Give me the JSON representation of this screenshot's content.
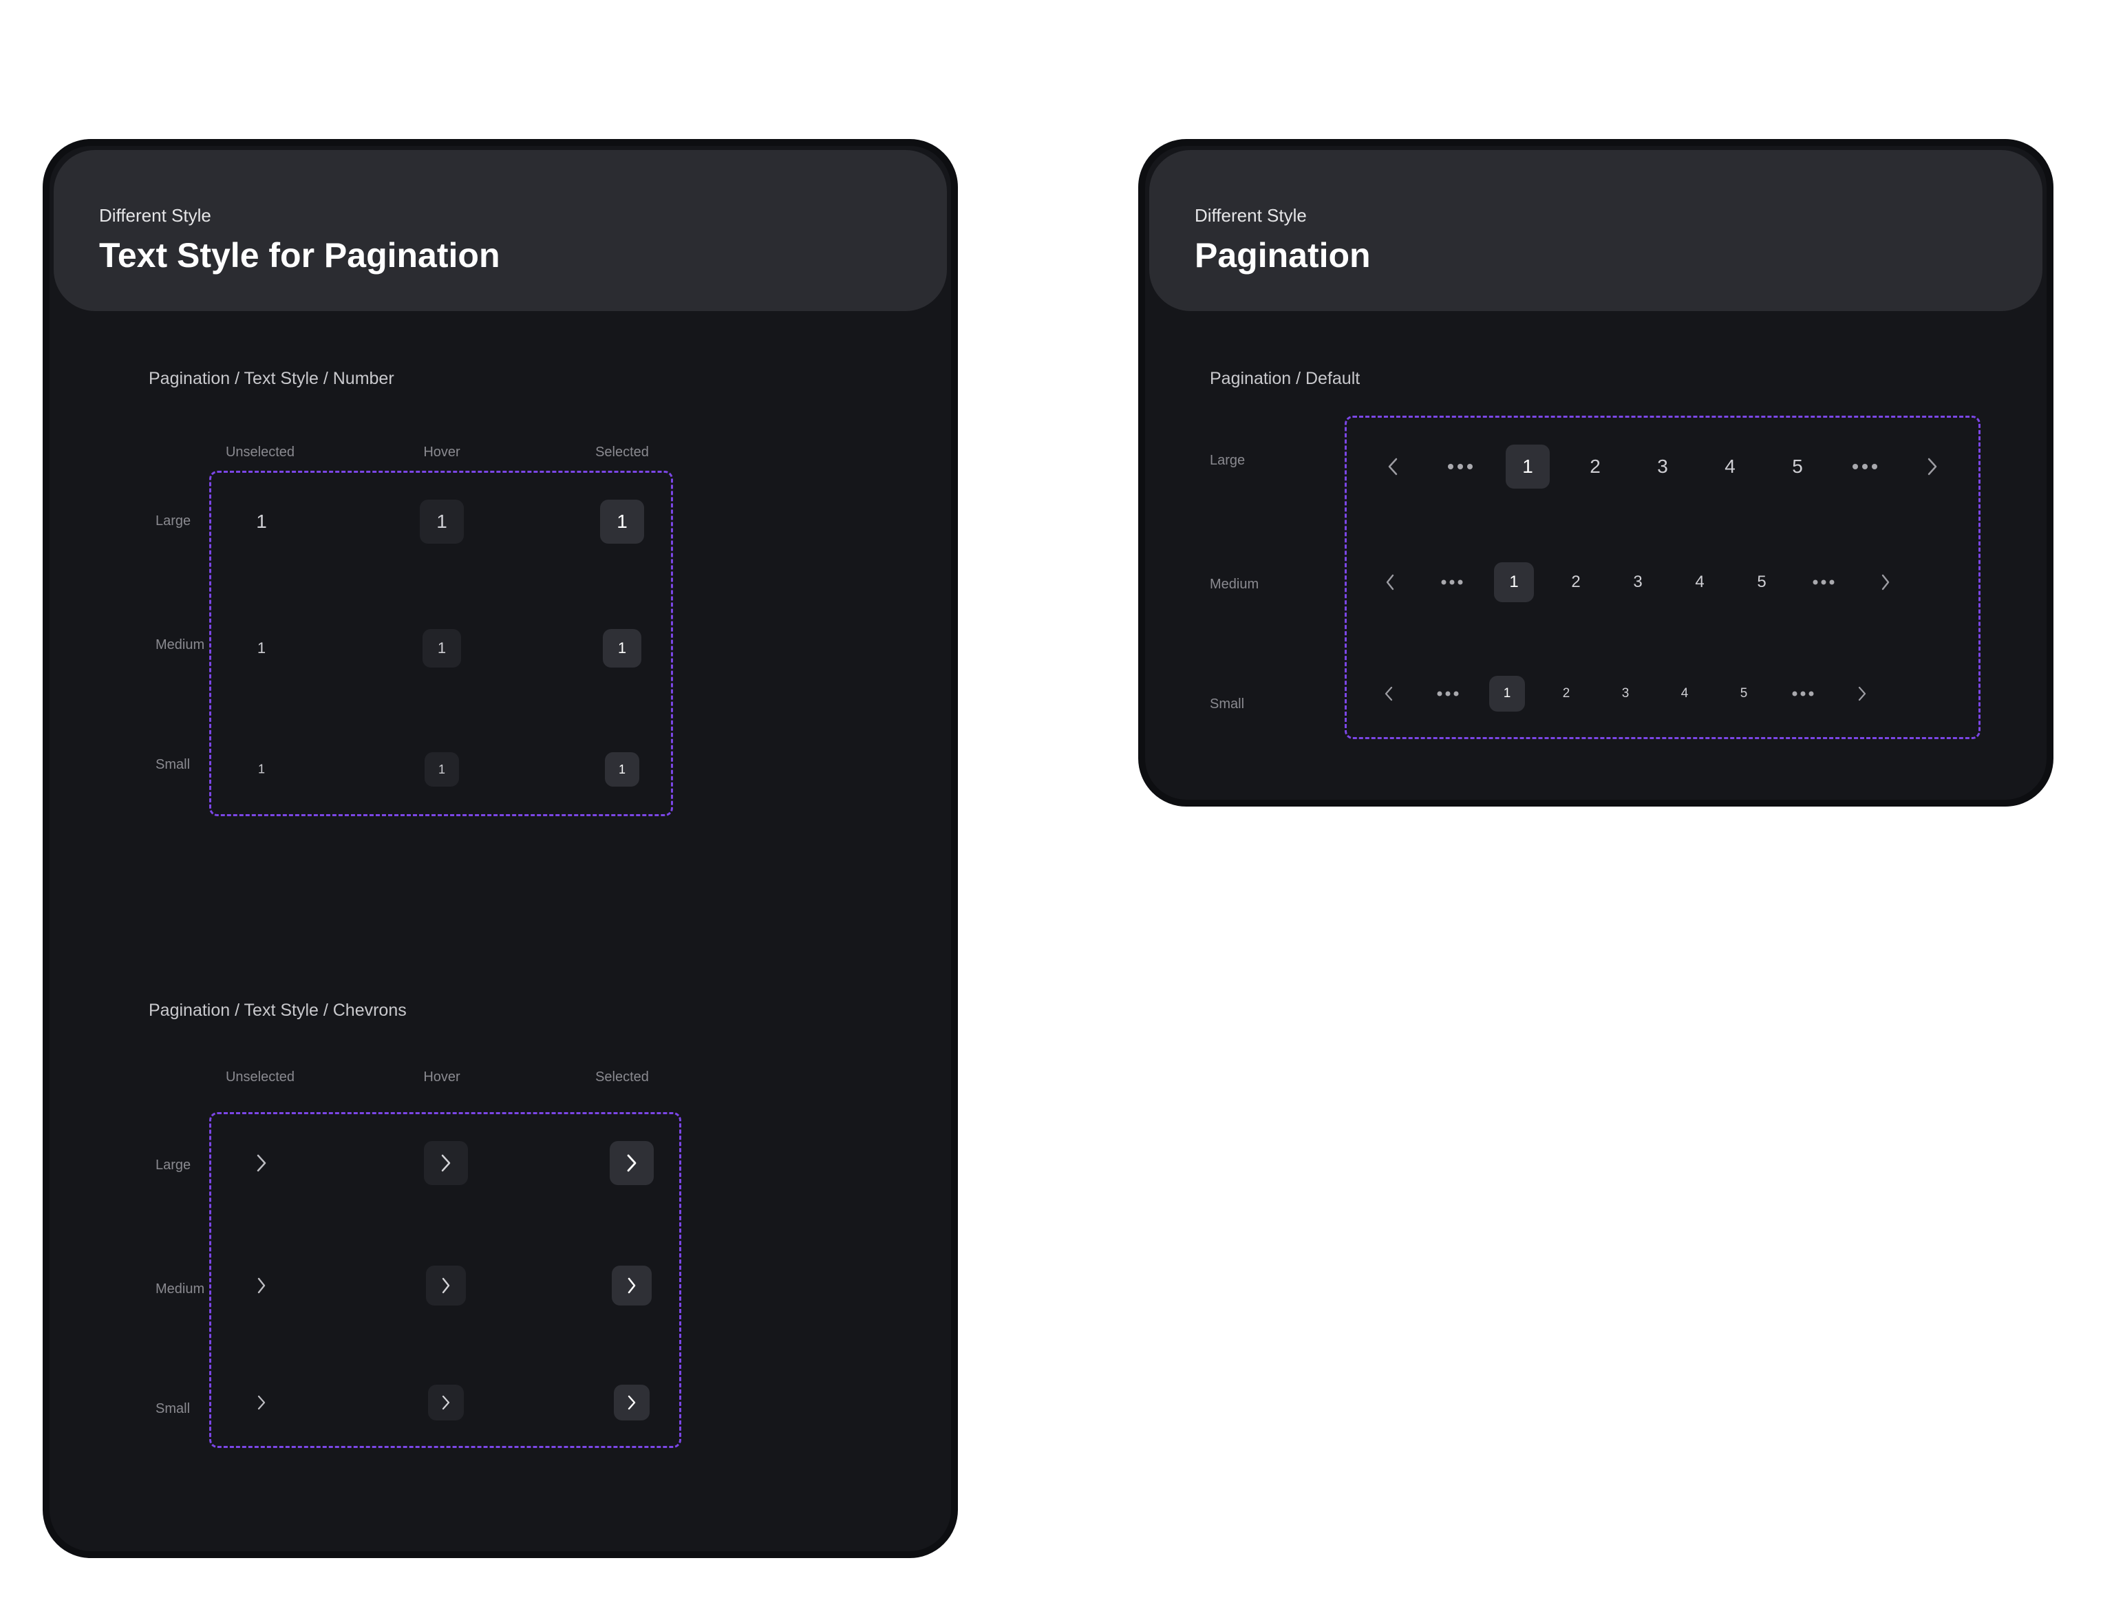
{
  "left_card": {
    "subtitle": "Different Style",
    "title": "Text Style for Pagination",
    "number_section": {
      "title": "Pagination / Text Style / Number",
      "columns": [
        "Unselected",
        "Hover",
        "Selected"
      ],
      "rows": [
        "Large",
        "Medium",
        "Small"
      ],
      "value": "1"
    },
    "chevron_section": {
      "title": "Pagination / Text Style / Chevrons",
      "columns": [
        "Unselected",
        "Hover",
        "Selected"
      ],
      "rows": [
        "Large",
        "Medium",
        "Small"
      ]
    }
  },
  "right_card": {
    "subtitle": "Different Style",
    "title": "Pagination",
    "default_section": {
      "title": "Pagination / Default",
      "rows": [
        "Large",
        "Medium",
        "Small"
      ],
      "pages": [
        "1",
        "2",
        "3",
        "4",
        "5"
      ],
      "selected_page": "1"
    }
  },
  "colors": {
    "card_bg": "#15161a",
    "header_bg": "#2b2c31",
    "dashed_outline": "#7b46e6",
    "hover_bg": "#222328",
    "selected_bg": "#2f3036"
  }
}
